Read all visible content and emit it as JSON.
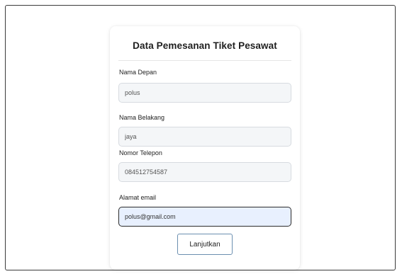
{
  "form": {
    "title": "Data Pemesanan Tiket Pesawat",
    "fields": [
      {
        "label": "Nama Depan",
        "value": "polus"
      },
      {
        "label": "Nama Belakang",
        "value": "jaya"
      },
      {
        "label": "Nomor Telepon",
        "value": "084512754587"
      },
      {
        "label": "Alamat email",
        "value": "polus@gmail.com"
      }
    ],
    "submit_label": "Lanjutkan"
  }
}
